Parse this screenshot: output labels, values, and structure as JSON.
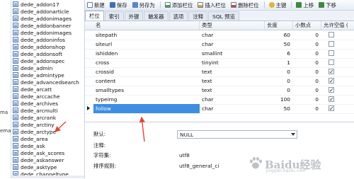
{
  "left_edge": {
    "fragments": [
      "ma",
      "ema"
    ]
  },
  "tree": {
    "items": [
      "dede_addon17",
      "dede_addonarticle",
      "dede_addonimages",
      "dede_addonbanner",
      "dede_addonimages",
      "dede_addoninfos",
      "dede_addonshop",
      "dede_addonsoft",
      "dede_addonspec",
      "dede_admin",
      "dede_admintype",
      "dede_advancedsearch",
      "dede_arcatt",
      "dede_arccache",
      "dede_archives",
      "dede_arcmulti",
      "dede_arcrank",
      "dede_arctiny",
      "dede_arctype",
      "dede_area",
      "dede_ask",
      "dede_ask_scores",
      "dede_askanswer",
      "dede_asktype",
      "dede_channeltype"
    ]
  },
  "toolbar": {
    "buttons": [
      {
        "label": "新建",
        "icon": "new-icon"
      },
      {
        "label": "保存",
        "icon": "save-icon"
      },
      {
        "label": "另存为",
        "icon": "save-as-icon"
      },
      {
        "label": "添加栏位",
        "icon": "add-column-icon"
      },
      {
        "label": "插入栏位",
        "icon": "insert-column-icon"
      },
      {
        "label": "删除栏位",
        "icon": "delete-column-icon"
      },
      {
        "label": "主键",
        "icon": "key-icon"
      },
      {
        "label": "上移",
        "icon": "arrow-up-icon"
      },
      {
        "label": "下移",
        "icon": "arrow-down-icon"
      }
    ]
  },
  "tabs": [
    "栏位",
    "索引",
    "外键",
    "触发器",
    "选项",
    "注释",
    "SQL 预览"
  ],
  "active_tab": 0,
  "grid": {
    "headers": [
      "名",
      "类型",
      "长度",
      "小数点",
      "允许空值 ("
    ],
    "rows": [
      {
        "name": "sitepath",
        "type": "char",
        "length": "60",
        "decimals": "0",
        "nullable": false
      },
      {
        "name": "siteurl",
        "type": "char",
        "length": "50",
        "decimals": "0",
        "nullable": false
      },
      {
        "name": "ishidden",
        "type": "smallint",
        "length": "6",
        "decimals": "0",
        "nullable": false
      },
      {
        "name": "cross",
        "type": "tinyint",
        "length": "1",
        "decimals": "0",
        "nullable": false
      },
      {
        "name": "crossid",
        "type": "text",
        "length": "0",
        "decimals": "0",
        "nullable": true
      },
      {
        "name": "content",
        "type": "text",
        "length": "0",
        "decimals": "0",
        "nullable": true
      },
      {
        "name": "smalltypes",
        "type": "text",
        "length": "0",
        "decimals": "0",
        "nullable": true
      },
      {
        "name": "typeimg",
        "type": "char",
        "length": "100",
        "decimals": "0",
        "nullable": true
      },
      {
        "name": "follow",
        "type": "char",
        "length": "50",
        "decimals": "0",
        "nullable": true
      }
    ],
    "selected_row": 8
  },
  "properties": {
    "default_label": "默认:",
    "default_value": "NULL",
    "comment_label": "注释:",
    "charset_label": "字符集:",
    "charset_value": "utf8",
    "collation_label": "排序规则:",
    "collation_value": "utf8_general_ci"
  },
  "watermark": {
    "text": "Baidu经验",
    "sub": "jingyan.baidu.com"
  },
  "colors": {
    "selection": "#3d8ee3",
    "annotation_arrow": "#e0463c"
  }
}
